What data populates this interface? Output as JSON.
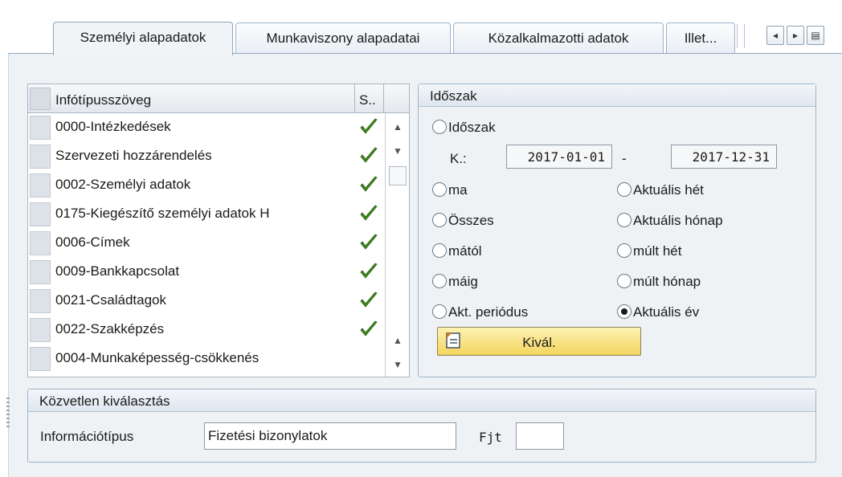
{
  "tabs": [
    {
      "label": "Személyi alapadatok",
      "active": true
    },
    {
      "label": "Munkaviszony alapadatai",
      "active": false
    },
    {
      "label": "Közalkalmazotti adatok",
      "active": false
    },
    {
      "label": "Illet...",
      "active": false
    }
  ],
  "tab_nav": {
    "prev": "◂",
    "next": "▸",
    "list": "▤"
  },
  "infotype_table": {
    "columns": [
      "Infótípusszöveg",
      "S.."
    ],
    "rows": [
      {
        "text": "0000-Intézkedések",
        "status": "check-icon"
      },
      {
        "text": "Szervezeti hozzárendelés",
        "status": "check-icon"
      },
      {
        "text": "0002-Személyi adatok",
        "status": "check-icon"
      },
      {
        "text": "0175-Kiegészítő személyi adatok H",
        "status": "check-icon"
      },
      {
        "text": "0006-Címek",
        "status": "check-icon"
      },
      {
        "text": "0009-Bankkapcsolat",
        "status": "check-icon"
      },
      {
        "text": "0021-Családtagok",
        "status": "check-icon"
      },
      {
        "text": "0022-Szakképzés",
        "status": "check-icon"
      },
      {
        "text": "0004-Munkaképesség-csökkenés",
        "status": ""
      }
    ],
    "scroll": {
      "up": "▲",
      "down": "▼"
    }
  },
  "period": {
    "title": "Időszak",
    "radio_period": "Időszak",
    "from_label": "K.:",
    "from_value": "2017-01-01",
    "dash": "-",
    "to_value": "2017-12-31",
    "options_left": [
      "ma",
      "Összes",
      "mától",
      "máig",
      "Akt. periódus"
    ],
    "options_right": [
      "Aktuális hét",
      "Aktuális hónap",
      "múlt hét",
      "múlt hónap",
      "Aktuális év"
    ],
    "selected": "Aktuális év",
    "select_button": "Kivál."
  },
  "direct_selection": {
    "title": "Közvetlen kiválasztás",
    "infotype_label": "Információtípus",
    "infotype_value": "Fizetési bizonylatok",
    "subtype_label": "Fjt",
    "subtype_value": ""
  },
  "colors": {
    "panel_bg": "#eff2f5",
    "border": "#9fb3c8",
    "check_green": "#3f8a1e",
    "button_yellow": "#f4d55e"
  }
}
